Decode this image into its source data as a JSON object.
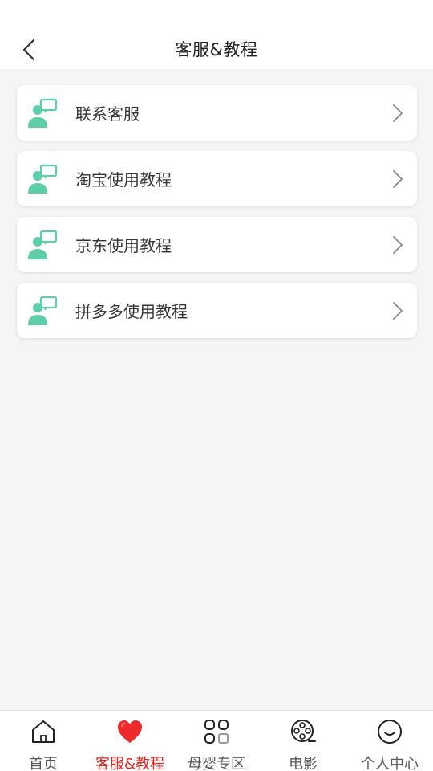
{
  "header": {
    "title": "客服&教程"
  },
  "menu": {
    "items": [
      {
        "label": "联系客服"
      },
      {
        "label": "淘宝使用教程"
      },
      {
        "label": "京东使用教程"
      },
      {
        "label": "拼多多使用教程"
      }
    ],
    "icon": "customer-service-icon",
    "icon_color": "#5ccfa6"
  },
  "tabbar": {
    "tabs": [
      {
        "label": "首页",
        "icon": "home-icon"
      },
      {
        "label": "客服&教程",
        "icon": "heart-icon"
      },
      {
        "label": "母婴专区",
        "icon": "grid-icon"
      },
      {
        "label": "电影",
        "icon": "film-reel-icon"
      },
      {
        "label": "个人中心",
        "icon": "smiley-icon"
      }
    ],
    "active_index": 1,
    "active_color": "#e5221c"
  }
}
